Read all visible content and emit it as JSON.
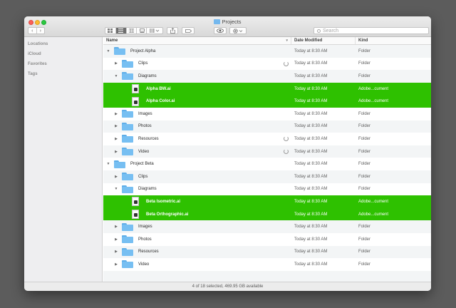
{
  "window": {
    "title": "Projects",
    "status": "4 of 18 selected, 469.95 GB available"
  },
  "toolbar": {
    "back": "‹",
    "forward": "›",
    "search_placeholder": "Search"
  },
  "sidebar": {
    "items": [
      "Locations",
      "iCloud",
      "Favorites",
      "Tags"
    ]
  },
  "columns": {
    "name": "Name",
    "date": "Date Modified",
    "kind": "Kind"
  },
  "colors": {
    "selection": "#2ec100",
    "folder": "#77bff2"
  },
  "rows": [
    {
      "name": "Project Alpha",
      "date": "Today at 8:30 AM",
      "kind": "Folder",
      "type": "folder",
      "level": 0,
      "expanded": true,
      "selected": false,
      "syncing": false
    },
    {
      "name": "Clips",
      "date": "Today at 8:30 AM",
      "kind": "Folder",
      "type": "folder",
      "level": 1,
      "expanded": false,
      "selected": false,
      "syncing": true
    },
    {
      "name": "Diagrams",
      "date": "Today at 8:30 AM",
      "kind": "Folder",
      "type": "folder",
      "level": 1,
      "expanded": true,
      "selected": false,
      "syncing": false
    },
    {
      "name": "Alpha BW.ai",
      "date": "Today at 8:30 AM",
      "kind": "Adobe...cument",
      "type": "file",
      "level": 2,
      "selected": true,
      "syncing": false
    },
    {
      "name": "Alpha Color.ai",
      "date": "Today at 8:30 AM",
      "kind": "Adobe...cument",
      "type": "file",
      "level": 2,
      "selected": true,
      "syncing": false
    },
    {
      "name": "Images",
      "date": "Today at 8:30 AM",
      "kind": "Folder",
      "type": "folder",
      "level": 1,
      "expanded": false,
      "selected": false,
      "syncing": false
    },
    {
      "name": "Photos",
      "date": "Today at 8:30 AM",
      "kind": "Folder",
      "type": "folder",
      "level": 1,
      "expanded": false,
      "selected": false,
      "syncing": false
    },
    {
      "name": "Resources",
      "date": "Today at 8:30 AM",
      "kind": "Folder",
      "type": "folder",
      "level": 1,
      "expanded": false,
      "selected": false,
      "syncing": true
    },
    {
      "name": "Video",
      "date": "Today at 8:30 AM",
      "kind": "Folder",
      "type": "folder",
      "level": 1,
      "expanded": false,
      "selected": false,
      "syncing": true
    },
    {
      "name": "Project Beta",
      "date": "Today at 8:30 AM",
      "kind": "Folder",
      "type": "folder",
      "level": 0,
      "expanded": true,
      "selected": false,
      "syncing": false
    },
    {
      "name": "Clips",
      "date": "Today at 8:30 AM",
      "kind": "Folder",
      "type": "folder",
      "level": 1,
      "expanded": false,
      "selected": false,
      "syncing": false
    },
    {
      "name": "Diagrams",
      "date": "Today at 8:30 AM",
      "kind": "Folder",
      "type": "folder",
      "level": 1,
      "expanded": true,
      "selected": false,
      "syncing": false
    },
    {
      "name": "Beta Isometric.ai",
      "date": "Today at 8:30 AM",
      "kind": "Adobe...cument",
      "type": "file",
      "level": 2,
      "selected": true,
      "syncing": false
    },
    {
      "name": "Beta Orthographic.ai",
      "date": "Today at 8:30 AM",
      "kind": "Adobe...cument",
      "type": "file",
      "level": 2,
      "selected": true,
      "syncing": false
    },
    {
      "name": "Images",
      "date": "Today at 8:30 AM",
      "kind": "Folder",
      "type": "folder",
      "level": 1,
      "expanded": false,
      "selected": false,
      "syncing": false
    },
    {
      "name": "Photos",
      "date": "Today at 8:30 AM",
      "kind": "Folder",
      "type": "folder",
      "level": 1,
      "expanded": false,
      "selected": false,
      "syncing": false
    },
    {
      "name": "Resources",
      "date": "Today at 8:30 AM",
      "kind": "Folder",
      "type": "folder",
      "level": 1,
      "expanded": false,
      "selected": false,
      "syncing": false
    },
    {
      "name": "Video",
      "date": "Today at 8:30 AM",
      "kind": "Folder",
      "type": "folder",
      "level": 1,
      "expanded": false,
      "selected": false,
      "syncing": false
    }
  ]
}
